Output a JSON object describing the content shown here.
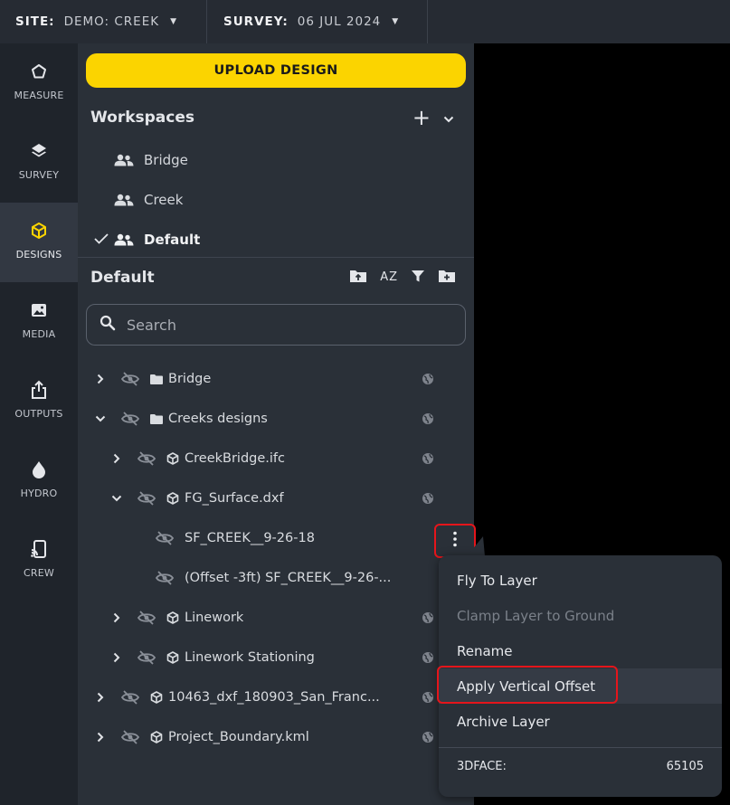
{
  "topbar": {
    "site_label": "SITE:",
    "site_value": "DEMO: CREEK",
    "survey_label": "SURVEY:",
    "survey_value": "06 JUL 2024"
  },
  "nav": [
    {
      "label": "MEASURE",
      "icon": "polygon-icon"
    },
    {
      "label": "SURVEY",
      "icon": "layers-icon"
    },
    {
      "label": "DESIGNS",
      "icon": "cube-icon",
      "active": true
    },
    {
      "label": "MEDIA",
      "icon": "image-icon"
    },
    {
      "label": "OUTPUTS",
      "icon": "share-icon"
    },
    {
      "label": "HYDRO",
      "icon": "drop-icon"
    },
    {
      "label": "CREW",
      "icon": "cast-icon"
    }
  ],
  "panel": {
    "upload_label": "UPLOAD DESIGN",
    "workspaces_title": "Workspaces",
    "workspaces": [
      {
        "name": "Bridge",
        "selected": false
      },
      {
        "name": "Creek",
        "selected": false
      },
      {
        "name": "Default",
        "selected": true
      }
    ],
    "default_title": "Default",
    "sort_label": "AZ",
    "search_placeholder": "Search",
    "tree": [
      {
        "name": "Bridge",
        "kind": "folder",
        "level": 0,
        "expanded": false
      },
      {
        "name": "Creeks designs",
        "kind": "folder",
        "level": 0,
        "expanded": true
      },
      {
        "name": "CreekBridge.ifc",
        "kind": "model",
        "level": 1,
        "expanded": false
      },
      {
        "name": "FG_Surface.dxf",
        "kind": "model",
        "level": 1,
        "expanded": true
      },
      {
        "name": "SF_CREEK__9-26-18",
        "kind": "layer",
        "level": 2
      },
      {
        "name": "(Offset -3ft) SF_CREEK__9-26-...",
        "kind": "layer",
        "level": 2
      },
      {
        "name": "Linework",
        "kind": "model",
        "level": 1,
        "expanded": false
      },
      {
        "name": "Linework Stationing",
        "kind": "model",
        "level": 1,
        "expanded": false
      },
      {
        "name": "10463_dxf_180903_San_Franc...",
        "kind": "model",
        "level": 0,
        "expanded": false
      },
      {
        "name": "Project_Boundary.kml",
        "kind": "model",
        "level": 0,
        "expanded": false
      }
    ]
  },
  "menu": {
    "items": [
      {
        "label": "Fly To Layer",
        "disabled": false
      },
      {
        "label": "Clamp Layer to Ground",
        "disabled": true
      },
      {
        "label": "Rename",
        "disabled": false
      },
      {
        "label": "Apply Vertical Offset",
        "disabled": false,
        "highlighted": true
      },
      {
        "label": "Archive Layer",
        "disabled": false
      }
    ],
    "footer_label": "3DFACE:",
    "footer_value": "65105"
  },
  "colors": {
    "accent": "#fbd400",
    "highlight_box": "#e5151b",
    "panel_bg": "#2a3038",
    "nav_bg": "#1f242b"
  }
}
